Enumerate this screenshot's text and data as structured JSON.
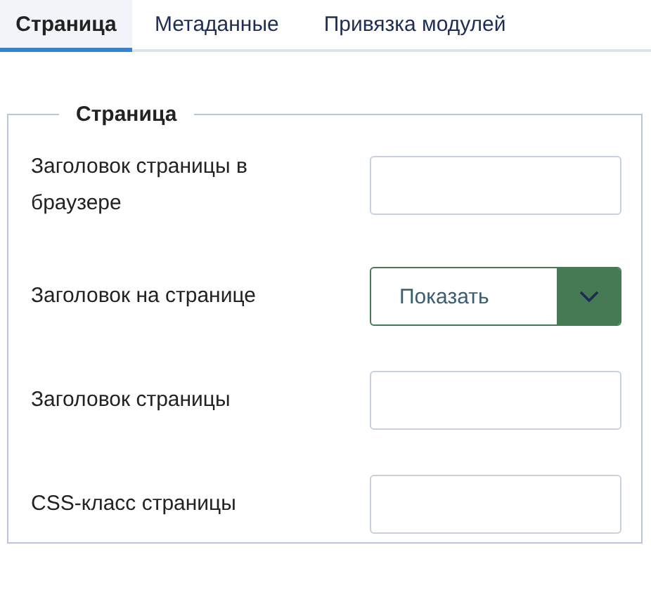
{
  "tabs": [
    {
      "label": "Страница",
      "selected": true
    },
    {
      "label": "Метаданные",
      "selected": false
    },
    {
      "label": "Привязка модулей",
      "selected": false
    }
  ],
  "fieldset": {
    "legend": "Страница",
    "fields": [
      {
        "kind": "text",
        "label": "Заголовок страницы в браузере"
      },
      {
        "kind": "select",
        "label": "Заголовок на странице",
        "value": "Показать"
      },
      {
        "kind": "text",
        "label": "Заголовок страницы"
      },
      {
        "kind": "text",
        "label": "CSS-класс страницы"
      }
    ]
  }
}
